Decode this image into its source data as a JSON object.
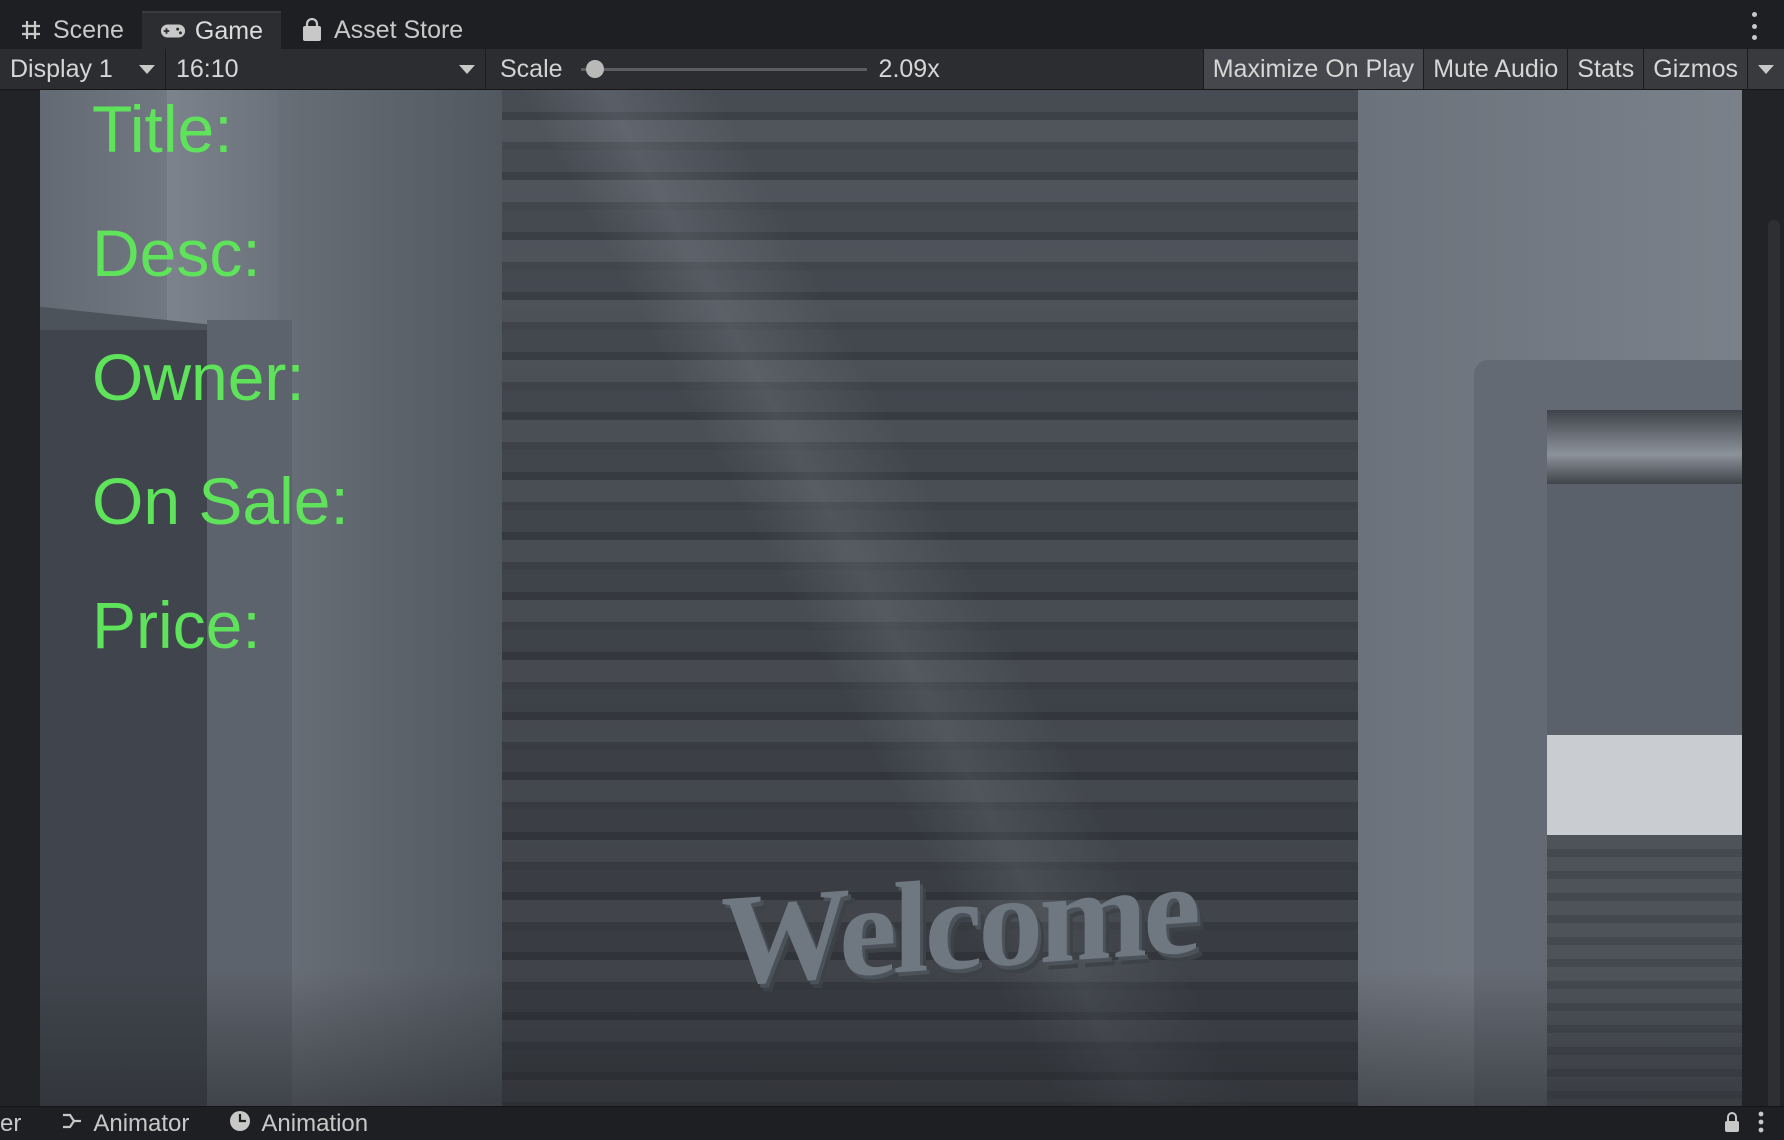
{
  "tabs": [
    {
      "label": "Scene",
      "icon": "grid-hash-icon"
    },
    {
      "label": "Game",
      "icon": "gamepad-icon"
    },
    {
      "label": "Asset Store",
      "icon": "shopping-bag-icon"
    }
  ],
  "toolbar": {
    "display": "Display 1",
    "aspect": "16:10",
    "scale_label": "Scale",
    "scale_value": "2.09x",
    "scale_level": 0.02,
    "maximize_on_play": "Maximize On Play",
    "mute_audio": "Mute Audio",
    "stats": "Stats",
    "gizmos": "Gizmos"
  },
  "game": {
    "fields": [
      "Title:",
      "Desc:",
      "Owner:",
      "On Sale:",
      "Price:"
    ],
    "welcome": "Welcome",
    "label_color": "#5ee35a"
  },
  "bottom_tabs": {
    "partial": "er",
    "animator": "Animator",
    "animation": "Animation"
  }
}
